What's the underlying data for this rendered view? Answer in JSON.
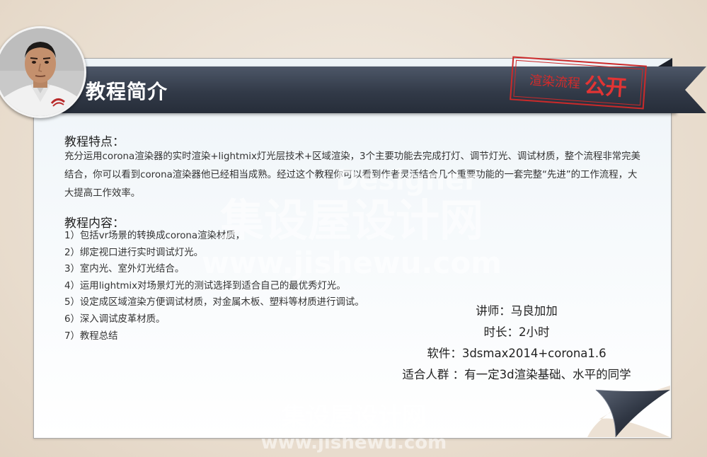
{
  "header": {
    "title": "教程简介"
  },
  "stamp": {
    "text": "渲染流程",
    "big": "公开",
    "color": "#d32b2b"
  },
  "features": {
    "heading": "教程特点：",
    "text": "充分运用corona渲染器的实时渲染+lightmix灯光层技术+区域渲染，3个主要功能去完成打灯、调节灯光、调试材质，整个流程非常完美结合，你可以看到corona渲染器他已经相当成熟。经过这个教程你可以看到作者灵活结合几个重要功能的一套完整“先进”的工作流程，大大提高工作效率。"
  },
  "contents": {
    "heading": "教程内容：",
    "items": [
      "1）包括vr场景的转换成corona渲染材质，",
      "2）绑定视口进行实时调试灯光。",
      "3）室内光、室外灯光结合。",
      "4）运用lightmix对场景灯光的测试选择到适合自己的最优秀灯光。",
      "5）设定成区域渲染方便调试材质，对金属木板、塑料等材质进行调试。",
      "6）深入调试皮革材质。",
      "7）教程总结"
    ]
  },
  "info": {
    "lecturer": "讲师：马良加加",
    "duration": "时长：2小时",
    "software": "软件：3dsmax2014+corona1.6",
    "audience": "适合人群 ：有一定3d渲染基础、水平的同学"
  },
  "watermark": {
    "brand_en": "Designer",
    "brand_cn": "集设屋设计网",
    "url": "www.jishewu.com",
    "brand_cn_small": "集设屋设计网",
    "url_small": "www.jishewu.com"
  },
  "colors": {
    "ribbon": "#323a48",
    "background": "#ece1d4",
    "accent": "#d32b2b"
  }
}
